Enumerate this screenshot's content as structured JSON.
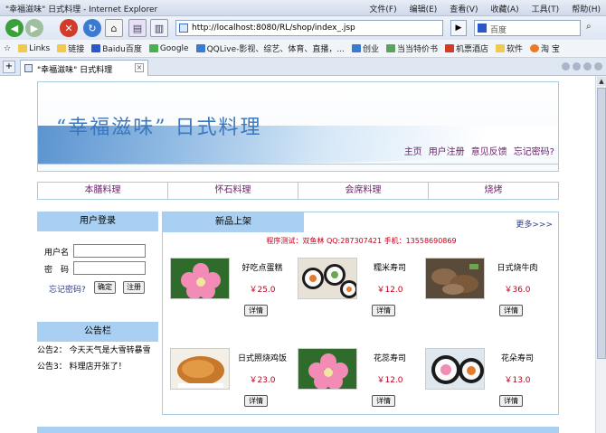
{
  "window": {
    "title": "\"幸福滋味\" 日式料理 - Internet Explorer",
    "menu": [
      "文件(F)",
      "编辑(E)",
      "查看(V)",
      "收藏(A)",
      "工具(T)",
      "帮助(H)"
    ]
  },
  "address": {
    "url": "http://localhost:8080/RL/shop/index_.jsp",
    "search_placeholder": "百度"
  },
  "favorites": [
    "Links",
    "链接",
    "Baidu百度",
    "Google",
    "QQLive-影视、综艺、体育、直播，...",
    "创业",
    "当当特价书",
    "机票酒店",
    "软件",
    "淘 宝"
  ],
  "tab": {
    "label": "\"幸福滋味\" 日式料理"
  },
  "banner": {
    "title": "“幸福滋味” 日式料理",
    "links": [
      "主页",
      "用户注册",
      "意见反馈",
      "忘记密码?"
    ]
  },
  "categories": [
    "本膳料理",
    "怀石料理",
    "会席料理",
    "烧烤"
  ],
  "login": {
    "heading": "用户登录",
    "username_label": "用户名",
    "password_label": "密　码",
    "forgot": "忘记密码?",
    "confirm": "确定",
    "register": "注册"
  },
  "notice": {
    "heading": "公告栏",
    "items": [
      "公告2： 今天天气是大雪转暴雪",
      "公告3： 料理店开张了！"
    ]
  },
  "new_products": {
    "heading": "新品上架",
    "more": "更多>>>",
    "test_line": "程序测试：双鱼林  QQ:287307421  手机：13558690869",
    "detail_label": "详情",
    "items": [
      {
        "name": "好吃点蛋糕",
        "price": "￥25.0",
        "image": "pink-flower-sushi"
      },
      {
        "name": "糯米寿司",
        "price": "￥12.0",
        "image": "maki-rolls"
      },
      {
        "name": "日式烧牛肉",
        "price": "￥36.0",
        "image": "grilled-beef"
      },
      {
        "name": "日式照烧鸡饭",
        "price": "￥23.0",
        "image": "teriyaki-chicken"
      },
      {
        "name": "花蕊寿司",
        "price": "￥12.0",
        "image": "pink-flower-sushi"
      },
      {
        "name": "花朵寿司",
        "price": "￥13.0",
        "image": "flower-maki"
      }
    ]
  }
}
